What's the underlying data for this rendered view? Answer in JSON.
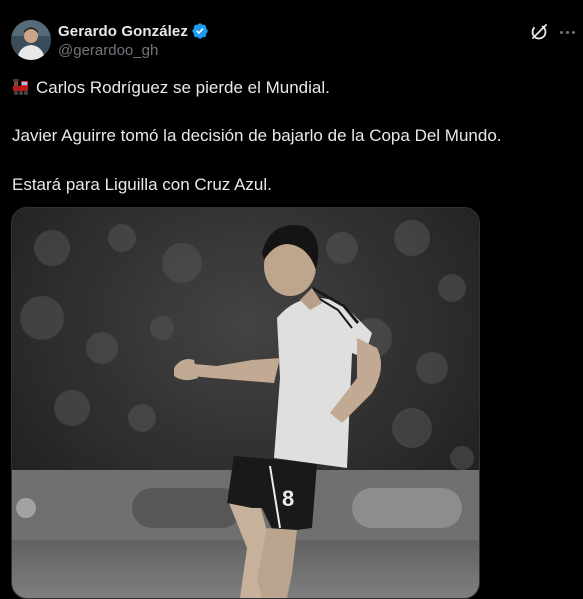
{
  "author": {
    "display_name": "Gerardo González",
    "handle": "@gerardoo_gh",
    "verified": true
  },
  "icons": {
    "verified": "verified-badge-icon",
    "grok": "grok-icon",
    "more": "more-options-icon",
    "emoji": "steam-locomotive-emoji"
  },
  "tweet": {
    "line1": "Carlos Rodríguez se pierde el Mundial.",
    "line2": "Javier Aguirre tomó la decisión de bajarlo de la Copa Del Mundo.",
    "line3": "Estará para Liguilla con Cruz Azul."
  },
  "media": {
    "jersey_number": "8"
  },
  "colors": {
    "background": "#000000",
    "text": "#e7e9ea",
    "secondary": "#71767b",
    "verified": "#1d9bf0",
    "border": "#2f3336"
  }
}
